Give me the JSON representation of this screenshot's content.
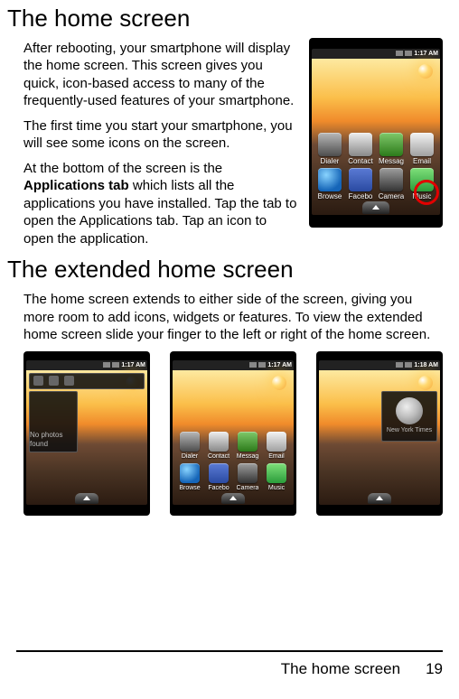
{
  "headings": {
    "h1a": "The home screen",
    "h1b": "The extended home screen"
  },
  "paragraphs": {
    "p1": "After rebooting, your smartphone will display the home screen. This screen gives you quick, icon-based access to many of the frequently-used features of your smartphone.",
    "p2": "The first time you start your smartphone, you will see some icons on the screen.",
    "p3a": "At the bottom of the screen is the ",
    "p3bold": "Applications tab",
    "p3b": " which lists all the applications you have installed. Tap the tab to open the Applications tab. Tap an icon to open the application.",
    "p4": "The home screen extends to either side of the screen, giving you more room to add icons, widgets or features. To view the extended home screen slide your finger to the left or right of the home screen."
  },
  "hero": {
    "time": "1:17 AM",
    "row1": [
      "Dialer",
      "Contact",
      "Messag",
      "Email"
    ],
    "row2": [
      "Browse",
      "Facebo",
      "Camera",
      "Music"
    ]
  },
  "ext": {
    "left": {
      "time": "1:17 AM",
      "photo_label": "No photos found"
    },
    "mid": {
      "time": "1:17 AM",
      "row1": [
        "Dialer",
        "Contact",
        "Messag",
        "Email"
      ],
      "row2": [
        "Browse",
        "Facebo",
        "Camera",
        "Music"
      ]
    },
    "right": {
      "time": "1:18 AM",
      "tile_label": "New York Times"
    }
  },
  "footer": {
    "title": "The home screen",
    "page": "19"
  }
}
